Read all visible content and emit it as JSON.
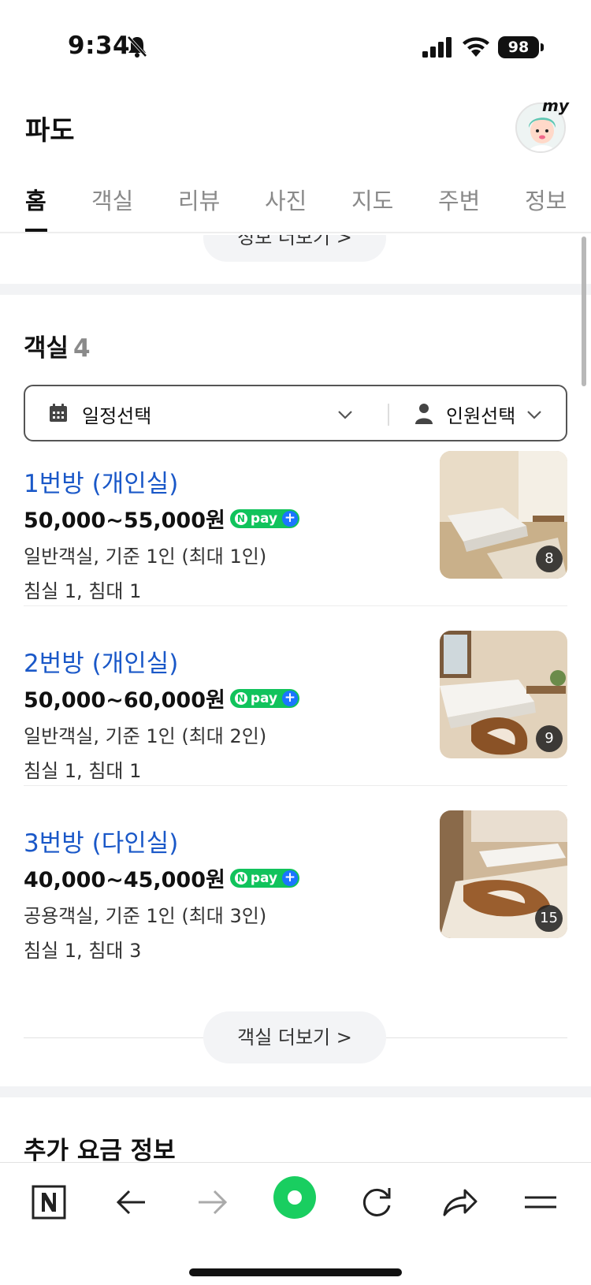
{
  "status_bar": {
    "time": "9:34",
    "battery": "98"
  },
  "header": {
    "title": "파도",
    "my_label": "my"
  },
  "tabs": [
    {
      "label": "홈"
    },
    {
      "label": "객실"
    },
    {
      "label": "리뷰"
    },
    {
      "label": "사진"
    },
    {
      "label": "지도"
    },
    {
      "label": "주변"
    },
    {
      "label": "정보"
    }
  ],
  "info_more": {
    "label": "정보 더보기 >"
  },
  "rooms_section": {
    "title": "객실",
    "count": "4",
    "date_filter": "일정선택",
    "people_filter": "인원선택",
    "items": [
      {
        "name": "1번방 (개인실)",
        "price": "50,000~55,000원",
        "npay": "pay",
        "desc": "일반객실, 기준 1인 (최대 1인)",
        "beds": "침실 1, 침대 1",
        "photo_count": "8"
      },
      {
        "name": "2번방 (개인실)",
        "price": "50,000~60,000원",
        "npay": "pay",
        "desc": "일반객실, 기준 1인 (최대 2인)",
        "beds": "침실 1, 침대 1",
        "photo_count": "9"
      },
      {
        "name": "3번방 (다인실)",
        "price": "40,000~45,000원",
        "npay": "pay",
        "desc": "공용객실, 기준 1인 (최대 3인)",
        "beds": "침실 1, 침대 3",
        "photo_count": "15"
      }
    ],
    "more_label": "객실 더보기 >"
  },
  "extra_fees": {
    "title": "추가 요금 정보"
  },
  "colors": {
    "accent_link": "#1a58c8",
    "npay_green": "#11c35c",
    "npay_plus": "#1a75ff",
    "naver_green": "#19ce60"
  },
  "toolbar": {
    "items": [
      "naver-n-icon",
      "back-arrow-icon",
      "forward-arrow-icon",
      "naver-green-dot-icon",
      "refresh-icon",
      "share-icon",
      "menu-icon"
    ]
  }
}
